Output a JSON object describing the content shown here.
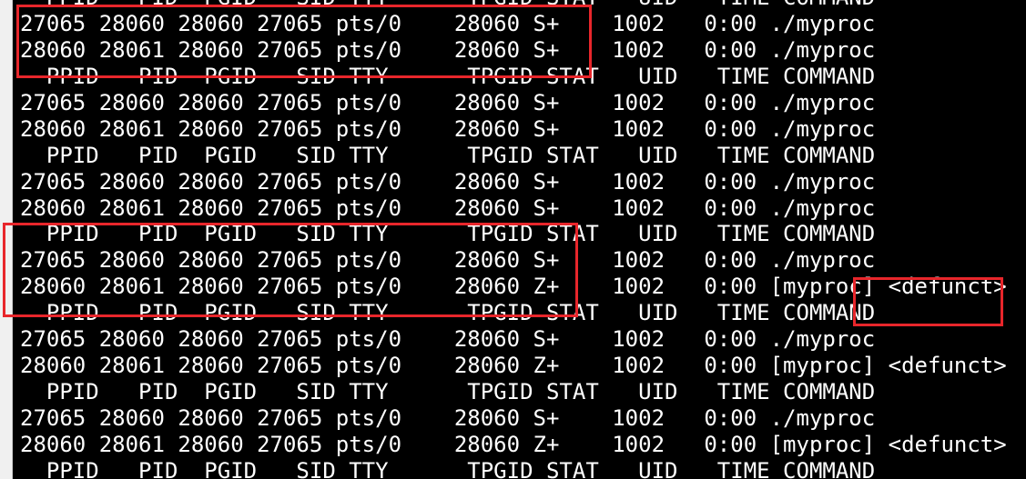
{
  "lines": [
    "  PPID   PID  PGID   SID TTY      TPGID STAT   UID   TIME COMMAND",
    "27065 28060 28060 27065 pts/0    28060 S+    1002   0:00 ./myproc",
    "28060 28061 28060 27065 pts/0    28060 S+    1002   0:00 ./myproc",
    "  PPID   PID  PGID   SID TTY      TPGID STAT   UID   TIME COMMAND",
    "27065 28060 28060 27065 pts/0    28060 S+    1002   0:00 ./myproc",
    "28060 28061 28060 27065 pts/0    28060 S+    1002   0:00 ./myproc",
    "  PPID   PID  PGID   SID TTY      TPGID STAT   UID   TIME COMMAND",
    "27065 28060 28060 27065 pts/0    28060 S+    1002   0:00 ./myproc",
    "28060 28061 28060 27065 pts/0    28060 S+    1002   0:00 ./myproc",
    "  PPID   PID  PGID   SID TTY      TPGID STAT   UID   TIME COMMAND",
    "27065 28060 28060 27065 pts/0    28060 S+    1002   0:00 ./myproc",
    "28060 28061 28060 27065 pts/0    28060 Z+    1002   0:00 [myproc] <defunct>",
    "  PPID   PID  PGID   SID TTY      TPGID STAT   UID   TIME COMMAND",
    "27065 28060 28060 27065 pts/0    28060 S+    1002   0:00 ./myproc",
    "28060 28061 28060 27065 pts/0    28060 Z+    1002   0:00 [myproc] <defunct>",
    "  PPID   PID  PGID   SID TTY      TPGID STAT   UID   TIME COMMAND",
    "27065 28060 28060 27065 pts/0    28060 S+    1002   0:00 ./myproc",
    "28060 28061 28060 27065 pts/0    28060 Z+    1002   0:00 [myproc] <defunct>",
    "  PPID   PID  PGID   SID TTY      TPGID STAT   UID   TIME COMMAND"
  ],
  "colors": {
    "background": "#000000",
    "text": "#ffffff",
    "highlight": "#e8262b"
  }
}
